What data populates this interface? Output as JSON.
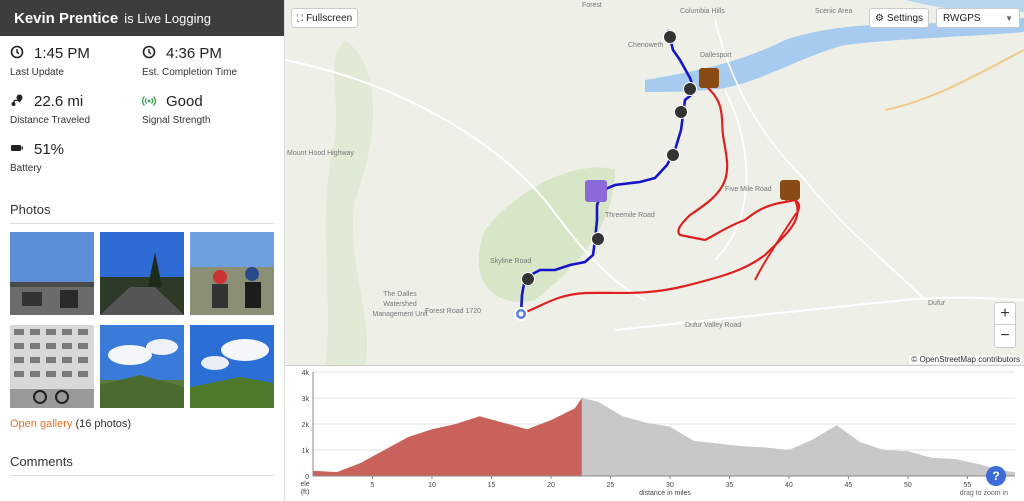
{
  "header": {
    "name": "Kevin Prentice",
    "suffix": "is Live Logging"
  },
  "stats": [
    {
      "icon": "clock-icon",
      "value": "1:45 PM",
      "label": "Last Update"
    },
    {
      "icon": "clock-icon",
      "value": "4:36 PM",
      "label": "Est. Completion Time"
    },
    {
      "icon": "route-icon",
      "value": "22.6 mi",
      "label": "Distance Traveled"
    },
    {
      "icon": "signal-icon",
      "value": "Good",
      "label": "Signal Strength"
    },
    {
      "icon": "battery-icon",
      "value": "51%",
      "label": "Battery"
    }
  ],
  "photos": {
    "title": "Photos",
    "gallery_link": "Open gallery",
    "gallery_count": "(16 photos)"
  },
  "comments": {
    "title": "Comments"
  },
  "map": {
    "fullscreen_label": "Fullscreen",
    "settings_label": "Settings",
    "layer_select": "RWGPS",
    "attribution": "© OpenStreetMap contributors",
    "places": [
      "Forest",
      "Chenoweth",
      "Dallesport",
      "The Dalles Watershed Management Unit",
      "Dufur",
      "Skyline Road",
      "Forest Road 1720",
      "Dufur Valley Road",
      "Five Mile Road",
      "Threemile Road",
      "Mount Hood Highway",
      "Columbia Hills",
      "Scenic Area"
    ],
    "colors": {
      "completed": "#1414c8",
      "planned": "#e02020",
      "water": "#9fc6e8",
      "forest": "#cfe2be"
    }
  },
  "elevation": {
    "y_ticks": [
      "4k",
      "3k",
      "2k",
      "1k",
      "0"
    ],
    "x_ticks": [
      "5",
      "10",
      "15",
      "20",
      "25",
      "30",
      "35",
      "40",
      "45",
      "50",
      "55"
    ],
    "ylabel": "ele\n(ft)",
    "xlabel": "distance in miles",
    "hint": "drag to zoom in",
    "colors": {
      "done": "#c9625a",
      "remaining": "#c8c8c8"
    }
  },
  "chart_data": {
    "type": "area",
    "xlabel": "distance in miles",
    "ylabel": "ele (ft)",
    "ylim": [
      0,
      4000
    ],
    "xlim": [
      0,
      59
    ],
    "progress_mi": 22.6,
    "x": [
      0,
      2,
      4,
      6,
      8,
      10,
      12,
      14,
      16,
      18,
      20,
      22,
      22.6,
      24,
      26,
      28,
      30,
      32,
      34,
      36,
      38,
      40,
      42,
      44,
      46,
      48,
      50,
      52,
      54,
      56,
      58,
      59
    ],
    "y": [
      200,
      150,
      500,
      1000,
      1500,
      1800,
      2000,
      2300,
      2050,
      1800,
      2150,
      2600,
      3000,
      2850,
      2300,
      2050,
      1900,
      1350,
      1250,
      1150,
      1100,
      1000,
      1400,
      1950,
      1300,
      1000,
      950,
      700,
      650,
      450,
      200,
      150
    ]
  }
}
